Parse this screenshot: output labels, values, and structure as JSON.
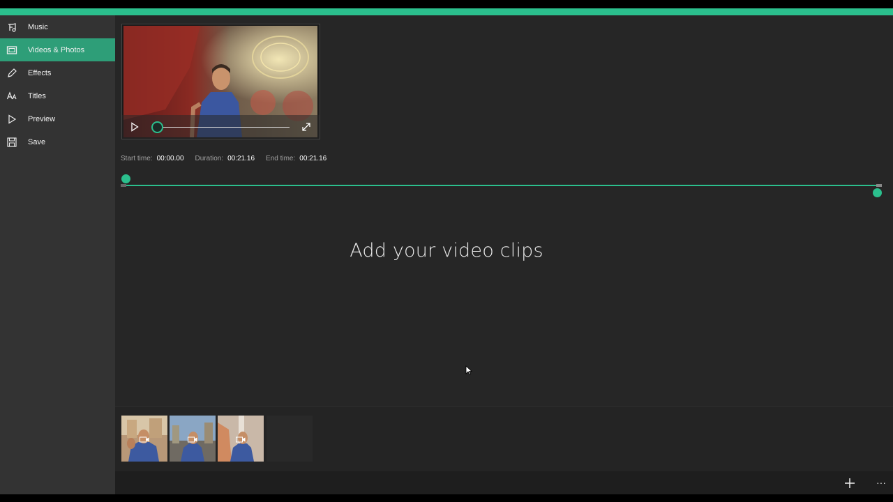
{
  "sidebar": {
    "items": [
      {
        "label": "Music",
        "icon": "music-note-icon",
        "active": false
      },
      {
        "label": "Videos & Photos",
        "icon": "photo-icon",
        "active": true
      },
      {
        "label": "Effects",
        "icon": "pencil-icon",
        "active": false
      },
      {
        "label": "Titles",
        "icon": "font-icon",
        "active": false
      },
      {
        "label": "Preview",
        "icon": "play-icon",
        "active": false
      },
      {
        "label": "Save",
        "icon": "floppy-disk-icon",
        "active": false
      }
    ]
  },
  "player": {
    "play_icon": "play-icon",
    "fullscreen_icon": "expand-icon",
    "position": 0
  },
  "times": {
    "start_label": "Start time:",
    "start_value": "00:00.00",
    "duration_label": "Duration:",
    "duration_value": "00:21.16",
    "end_label": "End time:",
    "end_value": "00:21.16"
  },
  "trim": {
    "start": 0,
    "end": 1
  },
  "main": {
    "prompt": "Add your video clips"
  },
  "tray": {
    "clips": [
      {
        "kind": "video",
        "badge": "video-camera-icon"
      },
      {
        "kind": "video",
        "badge": "video-camera-icon"
      },
      {
        "kind": "video",
        "badge": "video-camera-icon"
      },
      {
        "kind": "placeholder"
      }
    ]
  },
  "commandbar": {
    "add_icon": "plus-icon",
    "more_label": "···"
  },
  "colors": {
    "accent": "#2bbf8d",
    "active_item": "#2e9e78",
    "background": "#262626",
    "sidebar": "#333333"
  }
}
